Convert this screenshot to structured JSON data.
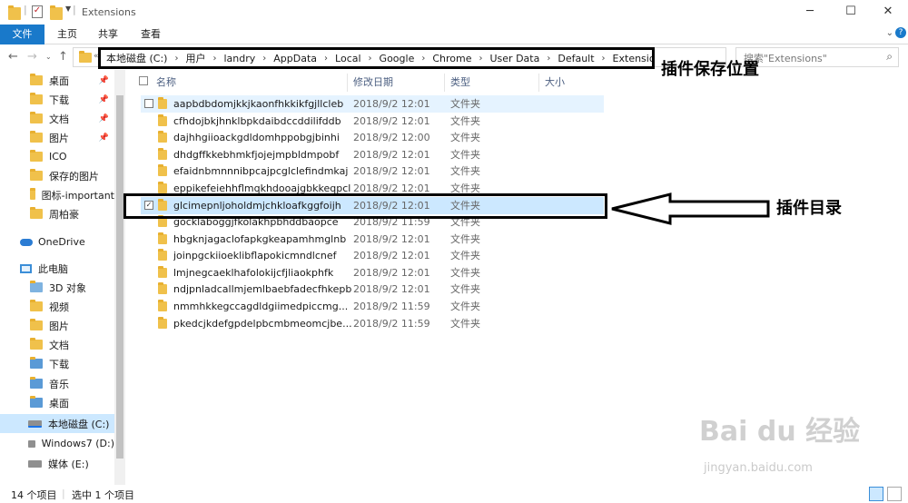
{
  "window": {
    "title": "Extensions",
    "minimize": "─",
    "maximize": "☐",
    "close": "✕"
  },
  "ribbon": {
    "tabs": [
      "文件",
      "主页",
      "共享",
      "查看"
    ]
  },
  "address": {
    "crumbs": [
      "本地磁盘 (C:)",
      "用户",
      "landry",
      "AppData",
      "Local",
      "Google",
      "Chrome",
      "User Data",
      "Default",
      "Extensions"
    ],
    "search_placeholder": "搜索\"Extensions\"",
    "annotation": "插件保存位置"
  },
  "sidebar": {
    "items": [
      {
        "label": "桌面",
        "pinned": true
      },
      {
        "label": "下载",
        "pinned": true
      },
      {
        "label": "文档",
        "pinned": true
      },
      {
        "label": "图片",
        "pinned": true
      },
      {
        "label": "ICO",
        "pinned": false
      },
      {
        "label": "保存的图片",
        "pinned": false
      },
      {
        "label": "图标-important",
        "pinned": false
      },
      {
        "label": "周柏豪",
        "pinned": false
      }
    ],
    "onedrive": "OneDrive",
    "thispc": "此电脑",
    "pc_items": [
      "3D 对象",
      "视频",
      "图片",
      "文档",
      "下载",
      "音乐",
      "桌面"
    ],
    "drives": [
      "本地磁盘 (C:)",
      "Windows7 (D:)",
      "媒体 (E:)"
    ]
  },
  "columns": {
    "name": "名称",
    "date": "修改日期",
    "type": "类型",
    "size": "大小"
  },
  "files": [
    {
      "name": "aapbdbdomjkkjkaonfhkkikfgjllcleb",
      "date": "2018/9/2 12:01",
      "type": "文件夹"
    },
    {
      "name": "cfhdojbkjhnklbpkdaibdccddilifddb",
      "date": "2018/9/2 12:01",
      "type": "文件夹"
    },
    {
      "name": "dajhhgiioackgdldomhppobgjbinhi",
      "date": "2018/9/2 12:00",
      "type": "文件夹"
    },
    {
      "name": "dhdgffkkebhmkfjojejmpbldmpobf",
      "date": "2018/9/2 12:01",
      "type": "文件夹"
    },
    {
      "name": "efaidnbmnnnibpcajpcglclefindmkaj",
      "date": "2018/9/2 12:01",
      "type": "文件夹"
    },
    {
      "name": "eppikefeiehhflmqkhdooajgbkkeqpcl",
      "date": "2018/9/2 12:01",
      "type": "文件夹"
    },
    {
      "name": "glcimepnljoholdmjchkloafkggfoijh",
      "date": "2018/9/2 12:01",
      "type": "文件夹"
    },
    {
      "name": "gocklaboggjfkolakhpbhddbaopce",
      "date": "2018/9/2 11:59",
      "type": "文件夹"
    },
    {
      "name": "hbgknjagaclofapkgkeapamhmglnb",
      "date": "2018/9/2 12:01",
      "type": "文件夹"
    },
    {
      "name": "joinpgckiioeklibflapokicmndlcnef",
      "date": "2018/9/2 12:01",
      "type": "文件夹"
    },
    {
      "name": "lmjnegcaeklhafolokijcfjliaokphfk",
      "date": "2018/9/2 12:01",
      "type": "文件夹"
    },
    {
      "name": "ndjpnladcallmjemlbaebfadecfhkepb",
      "date": "2018/9/2 12:01",
      "type": "文件夹"
    },
    {
      "name": "nmmhkkegccagdldgiimedpiccmg...",
      "date": "2018/9/2 11:59",
      "type": "文件夹"
    },
    {
      "name": "pkedcjkdefgpdelpbcmbmeomcjbe...",
      "date": "2018/9/2 11:59",
      "type": "文件夹"
    }
  ],
  "file_annotation": "插件目录",
  "status": {
    "count": "14 个项目",
    "selection": "选中 1 个项目"
  },
  "watermark": {
    "text": "Bai du 经验",
    "url": "jingyan.baidu.com"
  }
}
